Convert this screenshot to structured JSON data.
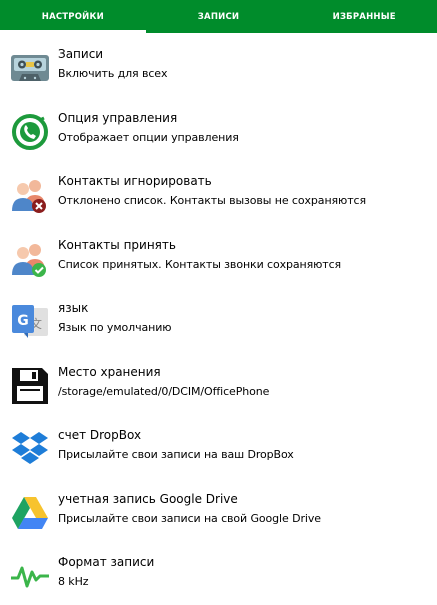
{
  "tabs": [
    {
      "label": "НАСТРОЙКИ",
      "active": true
    },
    {
      "label": "ЗАПИСИ",
      "active": false
    },
    {
      "label": "ИЗБРАННЫЕ",
      "active": false
    }
  ],
  "colors": {
    "accent": "#008c2b"
  },
  "settings": [
    {
      "icon": "cassette-tape-icon",
      "title": "Записи",
      "subtitle": "Включить для всех"
    },
    {
      "icon": "phone-control-icon",
      "title": "Опция управления",
      "subtitle": "Отображает опции управления"
    },
    {
      "icon": "contacts-ignore-icon",
      "title": "Контакты игнорировать",
      "subtitle": "Отклонено список. Контакты вызовы не сохраняются"
    },
    {
      "icon": "contacts-accept-icon",
      "title": "Контакты принять",
      "subtitle": "Список принятых. Контакты звонки сохраняются"
    },
    {
      "icon": "translate-icon",
      "title": "язык",
      "subtitle": "Язык по умолчанию"
    },
    {
      "icon": "floppy-disk-icon",
      "title": "Место хранения",
      "subtitle": "/storage/emulated/0/DCIM/OfficePhone"
    },
    {
      "icon": "dropbox-icon",
      "title": "счет DropBox",
      "subtitle": "Присылайте свои записи на ваш DropBox"
    },
    {
      "icon": "google-drive-icon",
      "title": "учетная запись Google Drive",
      "subtitle": "Присылайте свои записи на свой Google Drive"
    },
    {
      "icon": "waveform-icon",
      "title": "Формат записи",
      "subtitle": "8 kHz"
    }
  ]
}
